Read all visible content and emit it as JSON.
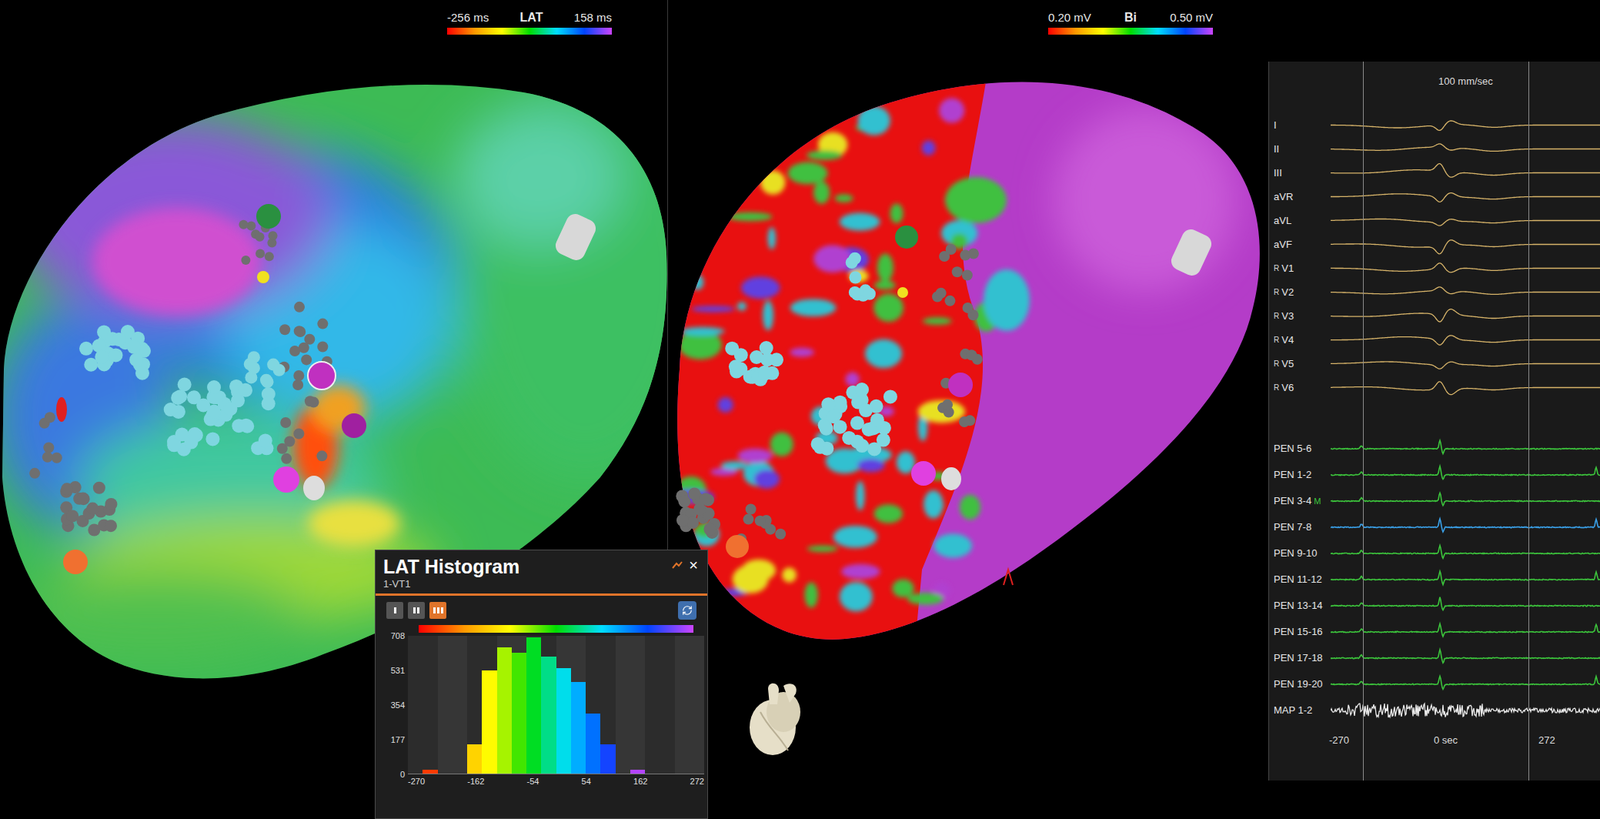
{
  "maps": [
    {
      "kind": "activation",
      "scale": {
        "min": "-256 ms",
        "label": "LAT",
        "max": "158 ms"
      }
    },
    {
      "kind": "voltage",
      "scale": {
        "min": "0.20 mV",
        "label": "Bi",
        "max": "0.50 mV"
      }
    }
  ],
  "histogram": {
    "title": "LAT Histogram",
    "subtitle": "1-VT1",
    "close": "×",
    "view_buttons": [
      {
        "selected": false
      },
      {
        "selected": false
      },
      {
        "selected": true
      }
    ],
    "bin_start": -270,
    "bin_width": 27.1,
    "counts": [
      0,
      20,
      0,
      0,
      150,
      530,
      650,
      620,
      700,
      600,
      540,
      470,
      310,
      150,
      0,
      20,
      0,
      0,
      0,
      0
    ],
    "y_max": 708,
    "y_ticks": [
      "708",
      "531",
      "354",
      "177",
      "0"
    ],
    "x_ticks": [
      "-270",
      "-162",
      "-54",
      "54",
      "162",
      "272"
    ]
  },
  "ecg": {
    "speed": "100 mm/sec",
    "channels": [
      {
        "label": "I",
        "tag": "",
        "marker": "",
        "kind": "surface",
        "color": "#d7b46a"
      },
      {
        "label": "II",
        "tag": "",
        "marker": "",
        "kind": "surface",
        "color": "#d7b46a"
      },
      {
        "label": "III",
        "tag": "",
        "marker": "",
        "kind": "surface",
        "color": "#d7b46a"
      },
      {
        "label": "aVR",
        "tag": "",
        "marker": "",
        "kind": "surface",
        "color": "#d7b46a"
      },
      {
        "label": "aVL",
        "tag": "",
        "marker": "",
        "kind": "surface",
        "color": "#d7b46a"
      },
      {
        "label": "aVF",
        "tag": "",
        "marker": "",
        "kind": "surface",
        "color": "#d7b46a"
      },
      {
        "label": "V1",
        "tag": "R",
        "marker": "",
        "kind": "surface",
        "color": "#d7b46a"
      },
      {
        "label": "V2",
        "tag": "R",
        "marker": "",
        "kind": "surface",
        "color": "#d7b46a"
      },
      {
        "label": "V3",
        "tag": "R",
        "marker": "",
        "kind": "surface",
        "color": "#d7b46a"
      },
      {
        "label": "V4",
        "tag": "R",
        "marker": "",
        "kind": "surface",
        "color": "#d7b46a"
      },
      {
        "label": "V5",
        "tag": "R",
        "marker": "",
        "kind": "surface",
        "color": "#d7b46a"
      },
      {
        "label": "V6",
        "tag": "R",
        "marker": "",
        "kind": "surface",
        "color": "#d7b46a"
      },
      {
        "label": "PEN 5-6",
        "tag": "",
        "marker": "",
        "kind": "pen",
        "color": "#3cc43c"
      },
      {
        "label": "PEN 1-2",
        "tag": "",
        "marker": "",
        "kind": "pen",
        "color": "#3cc43c"
      },
      {
        "label": "PEN 3-4",
        "tag": "",
        "marker": "M",
        "kind": "pen",
        "color": "#3cc43c"
      },
      {
        "label": "PEN 7-8",
        "tag": "",
        "marker": "",
        "kind": "pen",
        "color": "#3aa0e8"
      },
      {
        "label": "PEN 9-10",
        "tag": "",
        "marker": "",
        "kind": "pen",
        "color": "#3cc43c"
      },
      {
        "label": "PEN 11-12",
        "tag": "",
        "marker": "",
        "kind": "pen",
        "color": "#3cc43c"
      },
      {
        "label": "PEN 13-14",
        "tag": "",
        "marker": "",
        "kind": "pen",
        "color": "#3cc43c"
      },
      {
        "label": "PEN 15-16",
        "tag": "",
        "marker": "",
        "kind": "pen",
        "color": "#3cc43c"
      },
      {
        "label": "PEN 17-18",
        "tag": "",
        "marker": "",
        "kind": "pen",
        "color": "#3cc43c"
      },
      {
        "label": "PEN 19-20",
        "tag": "",
        "marker": "",
        "kind": "pen",
        "color": "#3cc43c"
      },
      {
        "label": "MAP 1-2",
        "tag": "",
        "marker": "",
        "kind": "map",
        "color": "#e8e8e8"
      }
    ],
    "time_axis": [
      "-270",
      "0 sec",
      "272"
    ]
  }
}
